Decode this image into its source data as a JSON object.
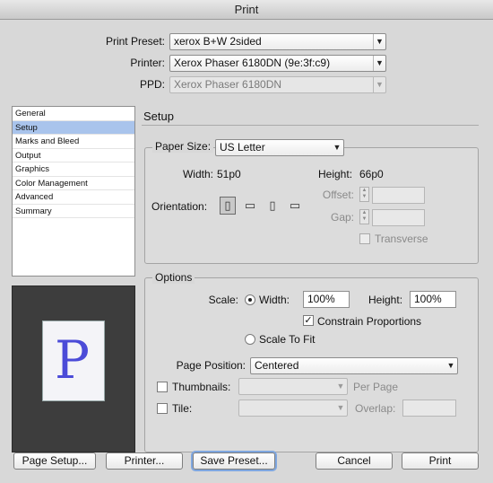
{
  "window": {
    "title": "Print"
  },
  "top": {
    "print_preset_label": "Print Preset:",
    "print_preset_value": "xerox B+W 2sided",
    "printer_label": "Printer:",
    "printer_value": "Xerox Phaser 6180DN (9e:3f:c9)",
    "ppd_label": "PPD:",
    "ppd_value": "Xerox Phaser 6180DN"
  },
  "sidebar": {
    "items": [
      {
        "label": "General"
      },
      {
        "label": "Setup"
      },
      {
        "label": "Marks and Bleed"
      },
      {
        "label": "Output"
      },
      {
        "label": "Graphics"
      },
      {
        "label": "Color Management"
      },
      {
        "label": "Advanced"
      },
      {
        "label": "Summary"
      }
    ],
    "selected": "Setup"
  },
  "preview": {
    "glyph": "P"
  },
  "setup": {
    "title": "Setup",
    "paper_size_label": "Paper Size:",
    "paper_size_value": "US Letter",
    "width_label": "Width:",
    "width_value": "51p0",
    "height_label": "Height:",
    "height_value": "66p0",
    "orientation_label": "Orientation:",
    "orientation_icons": [
      "portrait-icon",
      "landscape-icon",
      "reverse-portrait-icon",
      "reverse-landscape-icon"
    ],
    "offset_label": "Offset:",
    "gap_label": "Gap:",
    "transverse_label": "Transverse"
  },
  "options": {
    "title": "Options",
    "scale_label": "Scale:",
    "width_radio_label": "Width:",
    "width_value": "100%",
    "height_label": "Height:",
    "height_value": "100%",
    "constrain_label": "Constrain Proportions",
    "constrain_checked": true,
    "scale_to_fit_label": "Scale To Fit",
    "page_position_label": "Page Position:",
    "page_position_value": "Centered",
    "thumbnails_label": "Thumbnails:",
    "per_page_label": "Per Page",
    "tile_label": "Tile:",
    "overlap_label": "Overlap:"
  },
  "buttons": {
    "page_setup": "Page Setup...",
    "printer": "Printer...",
    "save_preset": "Save Preset...",
    "cancel": "Cancel",
    "print": "Print"
  }
}
